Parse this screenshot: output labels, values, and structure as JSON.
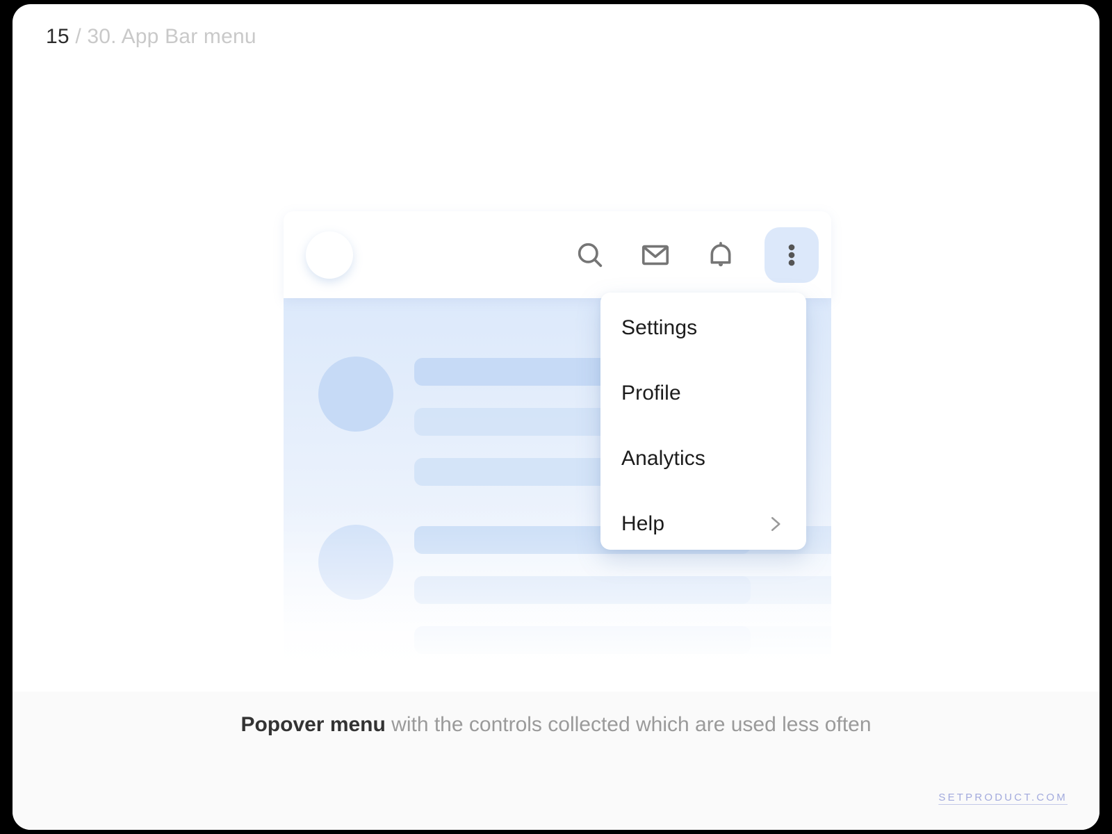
{
  "slide": {
    "index": "15",
    "total_label": "/ 30. App Bar menu"
  },
  "app_bar": {
    "avatar": "avatar-placeholder",
    "actions": [
      {
        "name": "search-icon",
        "label": "Search",
        "active": false
      },
      {
        "name": "mail-icon",
        "label": "Mail",
        "active": false
      },
      {
        "name": "bell-icon",
        "label": "Notifications",
        "active": false
      },
      {
        "name": "more-vertical-icon",
        "label": "More",
        "active": true
      }
    ]
  },
  "popover": {
    "items": [
      {
        "label": "Settings",
        "has_submenu": false
      },
      {
        "label": "Profile",
        "has_submenu": false
      },
      {
        "label": "Analytics",
        "has_submenu": false
      },
      {
        "label": "Help",
        "has_submenu": true
      }
    ],
    "submenu_icon": "chevron-right-icon"
  },
  "caption": {
    "strong": "Popover menu",
    "muted": " with the controls collected which are used less often"
  },
  "footer": {
    "watermark": "SETPRODUCT.COM"
  },
  "colors": {
    "page_background": "#ffffff",
    "outer_background": "#000000",
    "accent_active": "#dce8fa",
    "placeholder_blue": "#c6daf6",
    "content_gradient_top": "#dce9fb",
    "icon_gray": "#757575",
    "chevron_gray": "#9a9a9a",
    "caption_strong": "#333333",
    "caption_muted": "#9a9a9a",
    "watermark": "#a2aadd",
    "header_number": "#2b2b2b",
    "header_rest": "#c9c9c9"
  }
}
